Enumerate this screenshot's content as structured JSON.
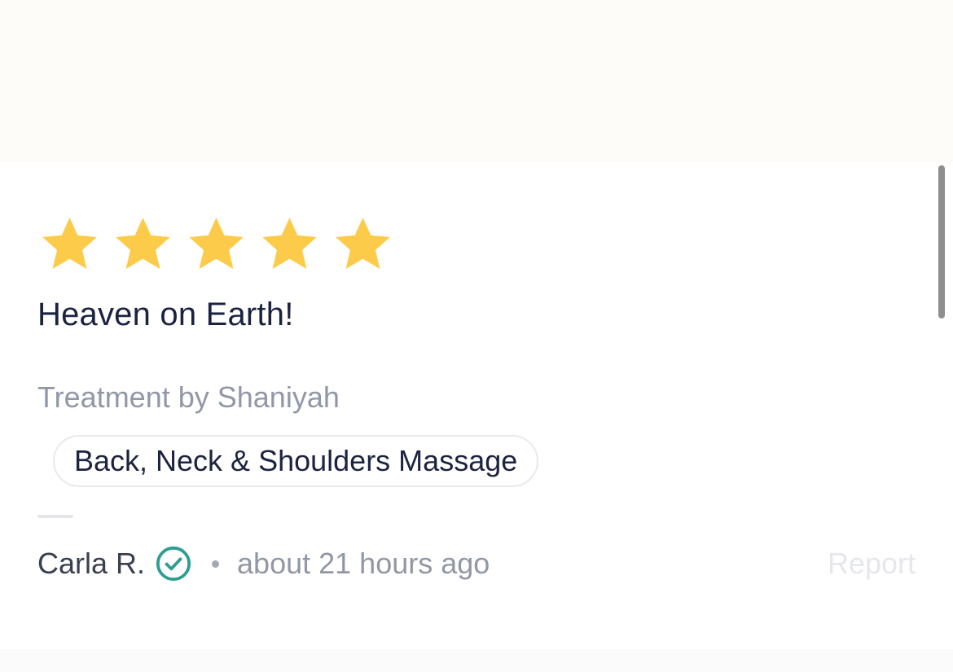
{
  "review": {
    "rating": 5,
    "rating_max": 5,
    "star_color": "#FDCB4A",
    "title": "Heaven on Earth!",
    "treatment_by": "Treatment by Shaniyah",
    "service_tag": "Back, Neck & Shoulders Massage",
    "author": "Carla R.",
    "verified_icon": "check-circle-icon",
    "verified_color": "#2E9E91",
    "time_ago": "about 21 hours ago",
    "report_label": "Report"
  }
}
